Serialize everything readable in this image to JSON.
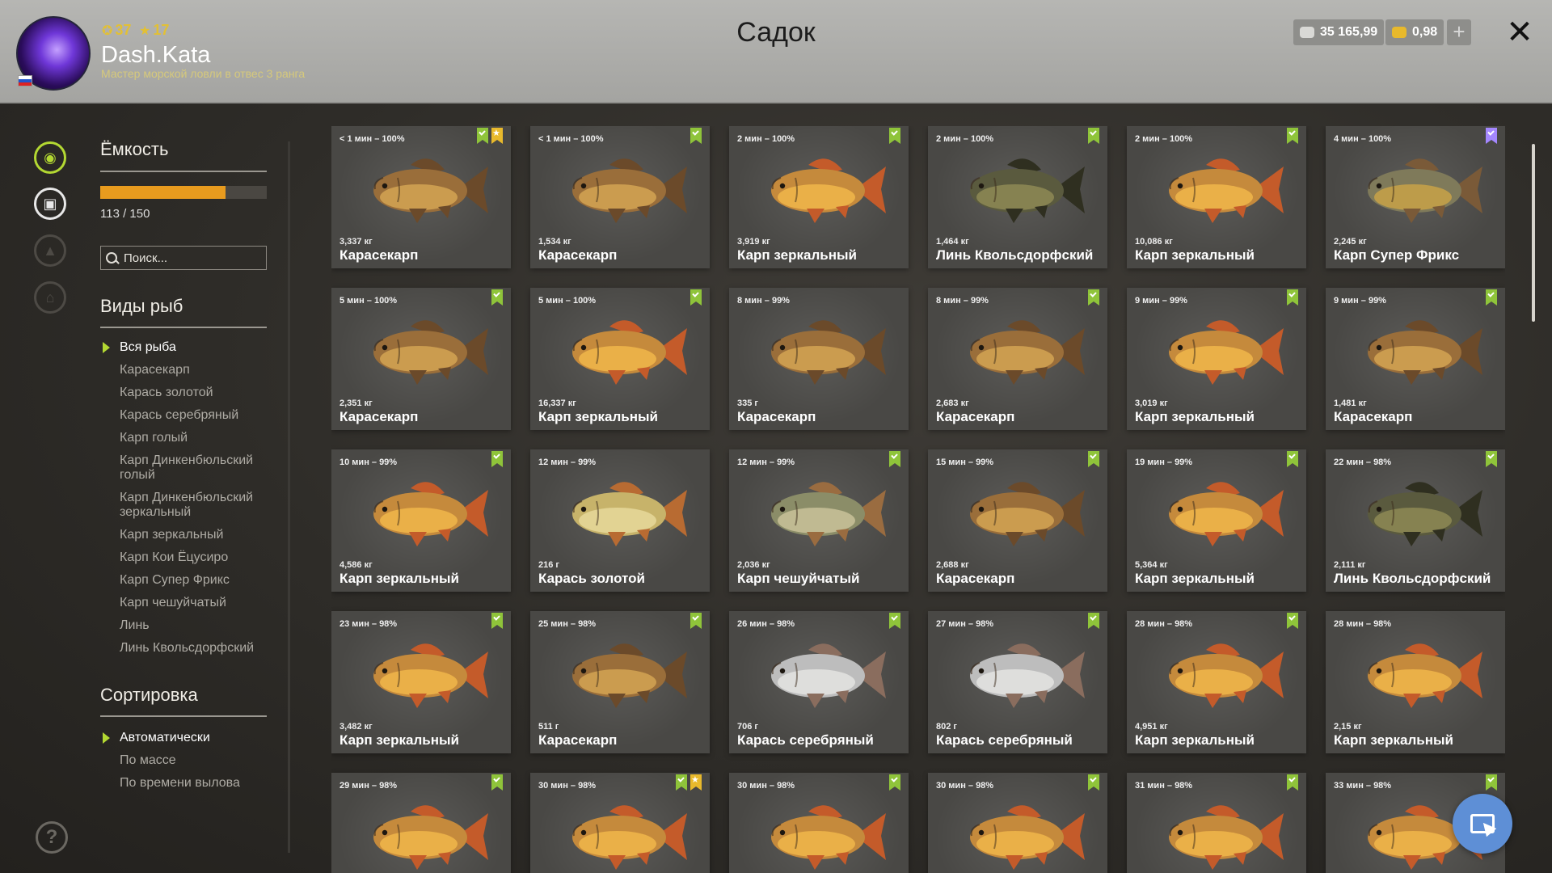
{
  "header": {
    "title": "Садок",
    "player": {
      "name": "Dash.Kata",
      "rank": "Мастер морской ловли в отвес 3 ранга",
      "level_a": "37",
      "level_b": "17"
    },
    "currency": {
      "silver": "35 165,99",
      "gold": "0,98"
    },
    "plus_label": "+",
    "close_label": "✕"
  },
  "colors": {
    "accent_green": "#b3d832",
    "capacity_orange": "#e89b1e",
    "bookmark_green": "#8fc43a",
    "bookmark_purple": "#a487ff",
    "bookmark_gold": "#e8b92c",
    "fab_blue": "#5e8fd6"
  },
  "rail": {
    "icons": [
      "fish-icon",
      "keepnet-icon",
      "trophy-icon",
      "home-icon"
    ],
    "help_label": "?"
  },
  "capacity": {
    "title": "Ёмкость",
    "current": 113,
    "max": 150,
    "text": "113 / 150"
  },
  "search": {
    "placeholder": "Поиск..."
  },
  "species": {
    "title": "Виды рыб",
    "items": [
      "Вся рыба",
      "Карасекарп",
      "Карась золотой",
      "Карась серебряный",
      "Карп голый",
      "Карп Динкенбюльский голый",
      "Карп Динкенбюльский зеркальный",
      "Карп зеркальный",
      "Карп Кои Ёцусиро",
      "Карп Супер Фрикс",
      "Карп чешуйчатый",
      "Линь",
      "Линь Квольсдорфский"
    ],
    "selected_index": 0
  },
  "sorting": {
    "title": "Сортировка",
    "items": [
      "Автоматически",
      "По массе",
      "По времени вылова"
    ],
    "selected_index": 0
  },
  "fish": [
    {
      "time": "< 1 мин – 100%",
      "weight": "3,337 кг",
      "name": "Карасекарп",
      "badges": [
        "green",
        "gold"
      ]
    },
    {
      "time": "< 1 мин – 100%",
      "weight": "1,534 кг",
      "name": "Карасекарп",
      "badges": [
        "green"
      ]
    },
    {
      "time": "2 мин – 100%",
      "weight": "3,919 кг",
      "name": "Карп зеркальный",
      "badges": [
        "green"
      ]
    },
    {
      "time": "2 мин – 100%",
      "weight": "1,464 кг",
      "name": "Линь Квольсдорфский",
      "badges": [
        "green"
      ]
    },
    {
      "time": "2 мин – 100%",
      "weight": "10,086 кг",
      "name": "Карп зеркальный",
      "badges": [
        "green"
      ]
    },
    {
      "time": "4 мин – 100%",
      "weight": "2,245 кг",
      "name": "Карп Супер Фрикс",
      "badges": [
        "purple"
      ]
    },
    {
      "time": "5 мин – 100%",
      "weight": "2,351 кг",
      "name": "Карасекарп",
      "badges": [
        "green"
      ]
    },
    {
      "time": "5 мин – 100%",
      "weight": "16,337 кг",
      "name": "Карп зеркальный",
      "badges": [
        "green"
      ]
    },
    {
      "time": "8 мин – 99%",
      "weight": "335 г",
      "name": "Карасекарп",
      "badges": []
    },
    {
      "time": "8 мин – 99%",
      "weight": "2,683 кг",
      "name": "Карасекарп",
      "badges": [
        "green"
      ]
    },
    {
      "time": "9 мин – 99%",
      "weight": "3,019 кг",
      "name": "Карп зеркальный",
      "badges": [
        "green"
      ]
    },
    {
      "time": "9 мин – 99%",
      "weight": "1,481 кг",
      "name": "Карасекарп",
      "badges": [
        "green"
      ]
    },
    {
      "time": "10 мин – 99%",
      "weight": "4,586 кг",
      "name": "Карп зеркальный",
      "badges": [
        "green"
      ]
    },
    {
      "time": "12 мин – 99%",
      "weight": "216 г",
      "name": "Карась золотой",
      "badges": []
    },
    {
      "time": "12 мин – 99%",
      "weight": "2,036 кг",
      "name": "Карп чешуйчатый",
      "badges": [
        "green"
      ]
    },
    {
      "time": "15 мин – 99%",
      "weight": "2,688 кг",
      "name": "Карасекарп",
      "badges": [
        "green"
      ]
    },
    {
      "time": "19 мин – 99%",
      "weight": "5,364 кг",
      "name": "Карп зеркальный",
      "badges": [
        "green"
      ]
    },
    {
      "time": "22 мин – 98%",
      "weight": "2,111 кг",
      "name": "Линь Квольсдорфский",
      "badges": [
        "green"
      ]
    },
    {
      "time": "23 мин – 98%",
      "weight": "3,482 кг",
      "name": "Карп зеркальный",
      "badges": [
        "green"
      ]
    },
    {
      "time": "25 мин – 98%",
      "weight": "511 г",
      "name": "Карасекарп",
      "badges": [
        "green"
      ]
    },
    {
      "time": "26 мин – 98%",
      "weight": "706 г",
      "name": "Карась серебряный",
      "badges": [
        "green"
      ]
    },
    {
      "time": "27 мин – 98%",
      "weight": "802 г",
      "name": "Карась серебряный",
      "badges": [
        "green"
      ]
    },
    {
      "time": "28 мин – 98%",
      "weight": "4,951 кг",
      "name": "Карп зеркальный",
      "badges": [
        "green"
      ]
    },
    {
      "time": "28 мин – 98%",
      "weight": "2,15 кг",
      "name": "Карп зеркальный",
      "badges": []
    },
    {
      "time": "29 мин – 98%",
      "weight": "",
      "name": "",
      "badges": [
        "green"
      ]
    },
    {
      "time": "30 мин – 98%",
      "weight": "",
      "name": "",
      "badges": [
        "green",
        "gold"
      ]
    },
    {
      "time": "30 мин – 98%",
      "weight": "",
      "name": "",
      "badges": [
        "green"
      ]
    },
    {
      "time": "30 мин – 98%",
      "weight": "",
      "name": "",
      "badges": [
        "green"
      ]
    },
    {
      "time": "31 мин – 98%",
      "weight": "",
      "name": "",
      "badges": [
        "green"
      ]
    },
    {
      "time": "33 мин – 98%",
      "weight": "",
      "name": "",
      "badges": [
        "green"
      ]
    }
  ]
}
